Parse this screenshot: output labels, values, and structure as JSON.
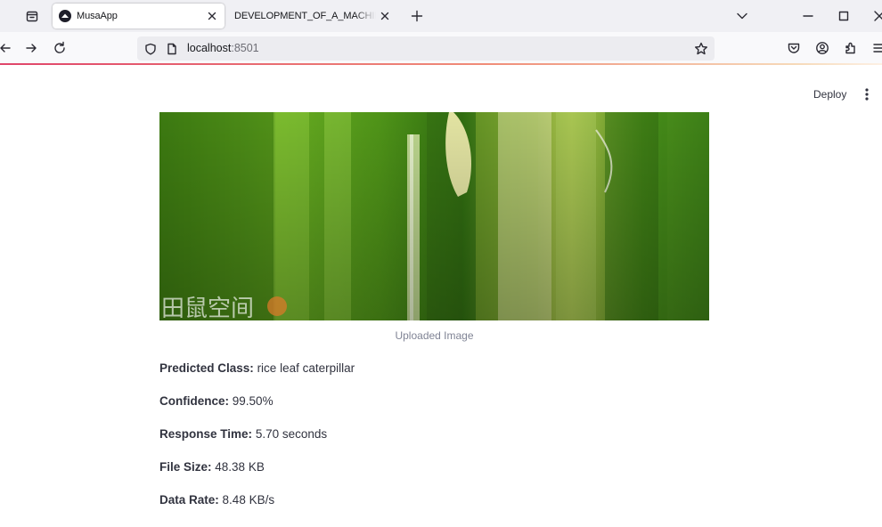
{
  "browser": {
    "tabs": [
      {
        "title": "MusaApp",
        "active": true
      },
      {
        "title": "DEVELOPMENT_OF_A_MACHINE_LE",
        "active": false
      }
    ],
    "url": {
      "host": "localhost",
      "port": ":8501"
    },
    "progress_gradient": [
      "#e0456a",
      "#f6d9b8"
    ]
  },
  "app": {
    "header": {
      "deploy_label": "Deploy"
    },
    "image": {
      "caption": "Uploaded Image",
      "watermark": "田鼠空间"
    },
    "results": [
      {
        "label": "Predicted Class:",
        "value": "rice leaf caterpillar"
      },
      {
        "label": "Confidence:",
        "value": "99.50%"
      },
      {
        "label": "Response Time:",
        "value": "5.70 seconds"
      },
      {
        "label": "File Size:",
        "value": "48.38 KB"
      },
      {
        "label": "Data Rate:",
        "value": "8.48 KB/s"
      }
    ]
  },
  "colors": {
    "tabstrip": "#f0f0f4",
    "navbar": "#f9f9fb",
    "urlbar": "#ececf0",
    "text": "#31333f",
    "caption": "#808495"
  }
}
